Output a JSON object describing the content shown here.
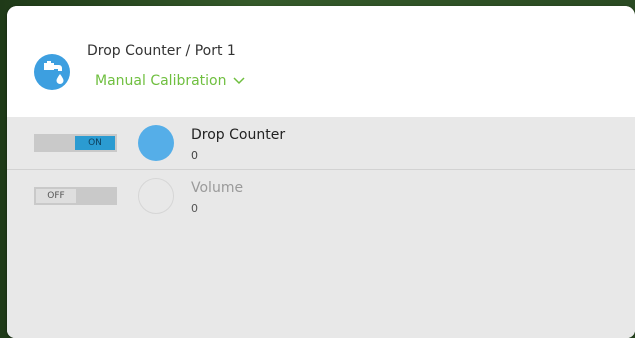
{
  "dialog": {
    "title": "Drop Counter / Port 1",
    "mode": "Manual Calibration",
    "icon": "faucet-drop-icon",
    "accent_color": "#6fbf3f",
    "icon_bg_color": "#3d9fe0"
  },
  "rows": [
    {
      "label": "Drop Counter",
      "value": "0",
      "toggle": "ON",
      "enabled": true,
      "indicator_color": "#55aee8"
    },
    {
      "label": "Volume",
      "value": "0",
      "toggle": "OFF",
      "enabled": false
    }
  ]
}
